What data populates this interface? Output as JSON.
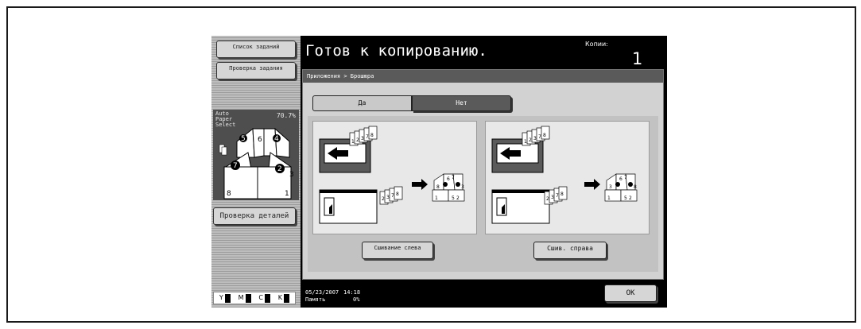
{
  "side": {
    "job_list_label": "Список заданий",
    "job_check_label": "Проверка задания",
    "auto_paper_select": "Auto Paper Select",
    "zoom_percent": "70.7%",
    "preview_page_numbers": [
      "1",
      "2",
      "3",
      "4",
      "5",
      "6",
      "7",
      "8"
    ],
    "detail_check_label": "Проверка деталей",
    "toner": [
      "Y",
      "M",
      "C",
      "K"
    ]
  },
  "header": {
    "status": "Готов к копированию.",
    "copies_label": "Копии:",
    "copies_value": "1"
  },
  "main": {
    "breadcrumb": "Приложения > Брошюра",
    "toggle": {
      "yes": "Да",
      "no": "Нет"
    },
    "options": [
      {
        "label": "Сшивание слева",
        "diagram_pages": [
          "1",
          "2",
          "3",
          "7",
          "8",
          "2",
          "3",
          "7",
          "8",
          "1",
          "2",
          "3",
          "5",
          "6",
          "7",
          "8"
        ]
      },
      {
        "label": "Сшив. справа",
        "diagram_pages": [
          "1",
          "2",
          "3",
          "7",
          "8",
          "2",
          "3",
          "7",
          "8",
          "1",
          "2",
          "3",
          "5",
          "6",
          "7",
          "8"
        ]
      }
    ]
  },
  "footer": {
    "date": "05/23/2007",
    "time": "14:18",
    "memory_label": "Память",
    "memory_value": "0%",
    "ok_label": "OK"
  },
  "colors": {
    "screen_bg": "#000000",
    "panel_bg": "#d2d2d2",
    "selected_tab": "#5a5a5a",
    "card_bg": "#e8e8e8"
  }
}
